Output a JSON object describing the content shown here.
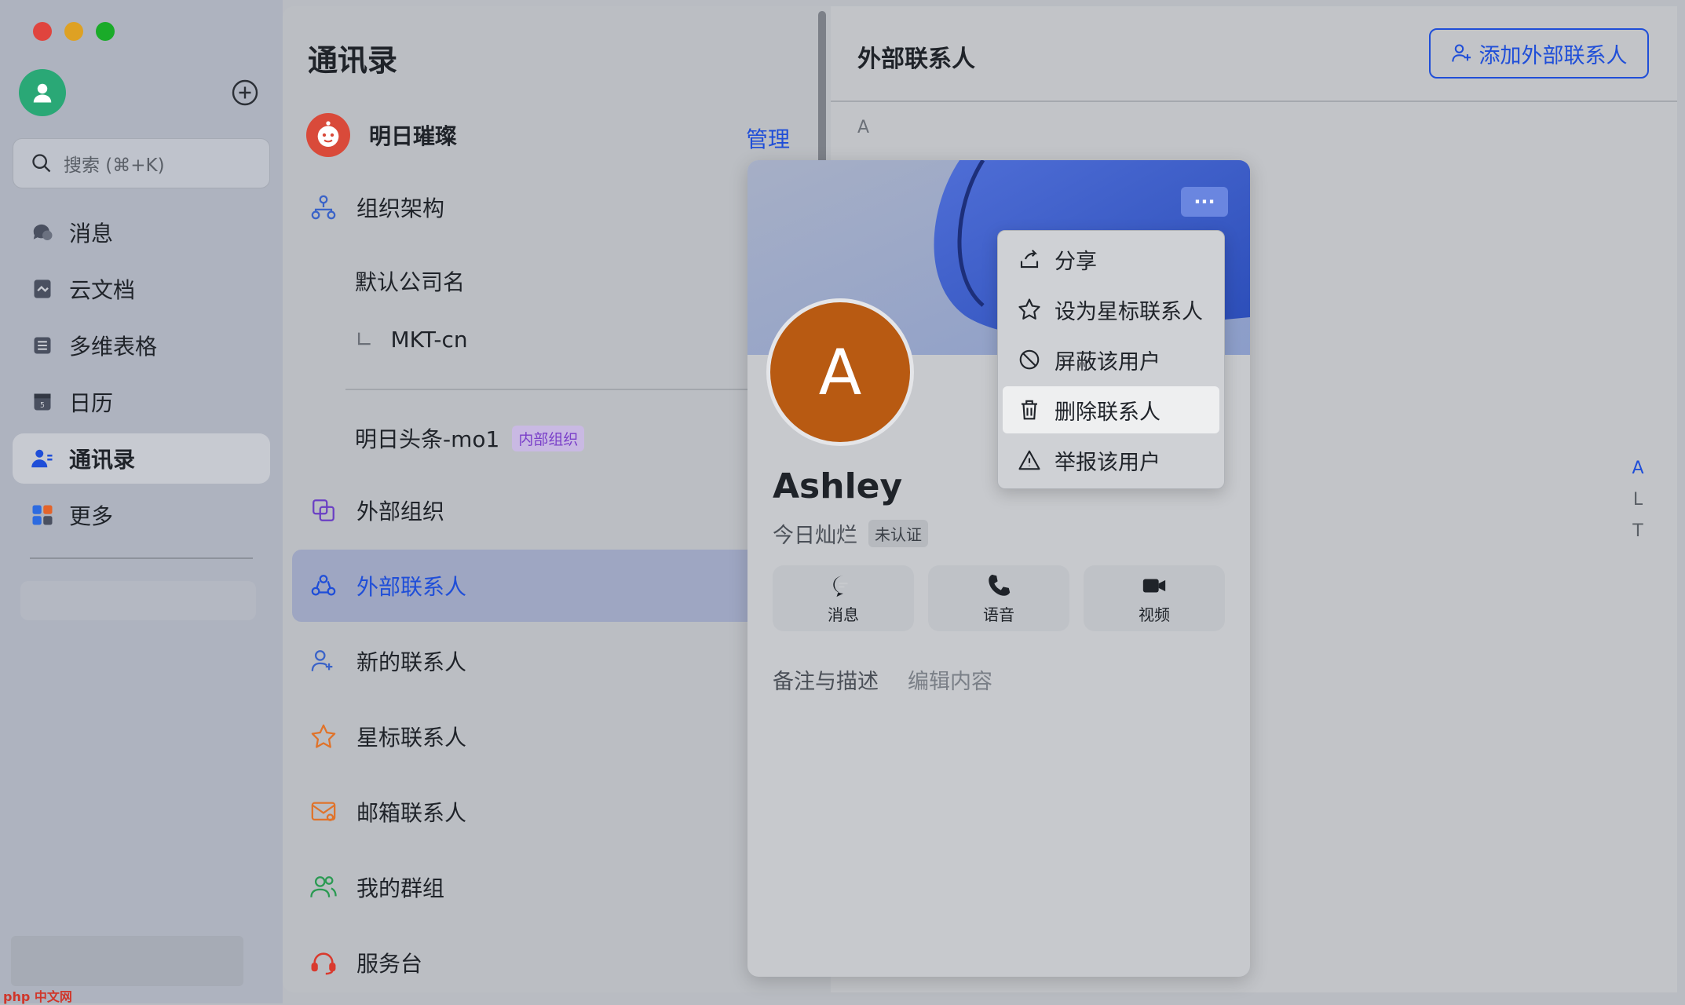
{
  "sidebar": {
    "search_placeholder": "搜索 (⌘+K)",
    "items": [
      {
        "label": "消息",
        "icon": "chat-icon"
      },
      {
        "label": "云文档",
        "icon": "document-icon"
      },
      {
        "label": "多维表格",
        "icon": "table-icon"
      },
      {
        "label": "日历",
        "icon": "calendar-icon"
      },
      {
        "label": "通讯录",
        "icon": "contacts-icon",
        "active": true
      },
      {
        "label": "更多",
        "icon": "apps-icon"
      }
    ]
  },
  "contacts": {
    "title": "通讯录",
    "org_name": "明日璀璨",
    "manage_label": "管理",
    "items": {
      "org_structure": "组织架构",
      "default_company": "默认公司名",
      "sub_dept": "MKT-cn",
      "sub_dept_prefix": "∟",
      "internal_org": "明日头条-mo1",
      "internal_badge": "内部组织",
      "external_org": "外部组织",
      "external_contacts": "外部联系人",
      "new_contacts": "新的联系人",
      "starred": "星标联系人",
      "mailbox": "邮箱联系人",
      "groups": "我的群组",
      "helpdesk": "服务台"
    }
  },
  "right": {
    "title": "外部联系人",
    "add_button": "添加外部联系人",
    "section_letter": "A",
    "az_index": [
      "A",
      "L",
      "T"
    ]
  },
  "card": {
    "avatar_letter": "A",
    "name": "Ashley",
    "company": "今日灿烂",
    "badge": "未认证",
    "more_label": "···",
    "actions": [
      {
        "label": "消息",
        "icon": "chat-bubble-icon"
      },
      {
        "label": "语音",
        "icon": "phone-icon"
      },
      {
        "label": "视频",
        "icon": "video-icon"
      }
    ],
    "notes_label": "备注与描述",
    "edit_label": "编辑内容"
  },
  "menu": {
    "items": [
      {
        "label": "分享",
        "icon": "share-icon"
      },
      {
        "label": "设为星标联系人",
        "icon": "star-icon"
      },
      {
        "label": "屏蔽该用户",
        "icon": "block-icon"
      },
      {
        "label": "删除联系人",
        "icon": "trash-icon",
        "highlighted": true
      },
      {
        "label": "举报该用户",
        "icon": "warning-icon"
      }
    ]
  },
  "watermark": "php 中文网"
}
